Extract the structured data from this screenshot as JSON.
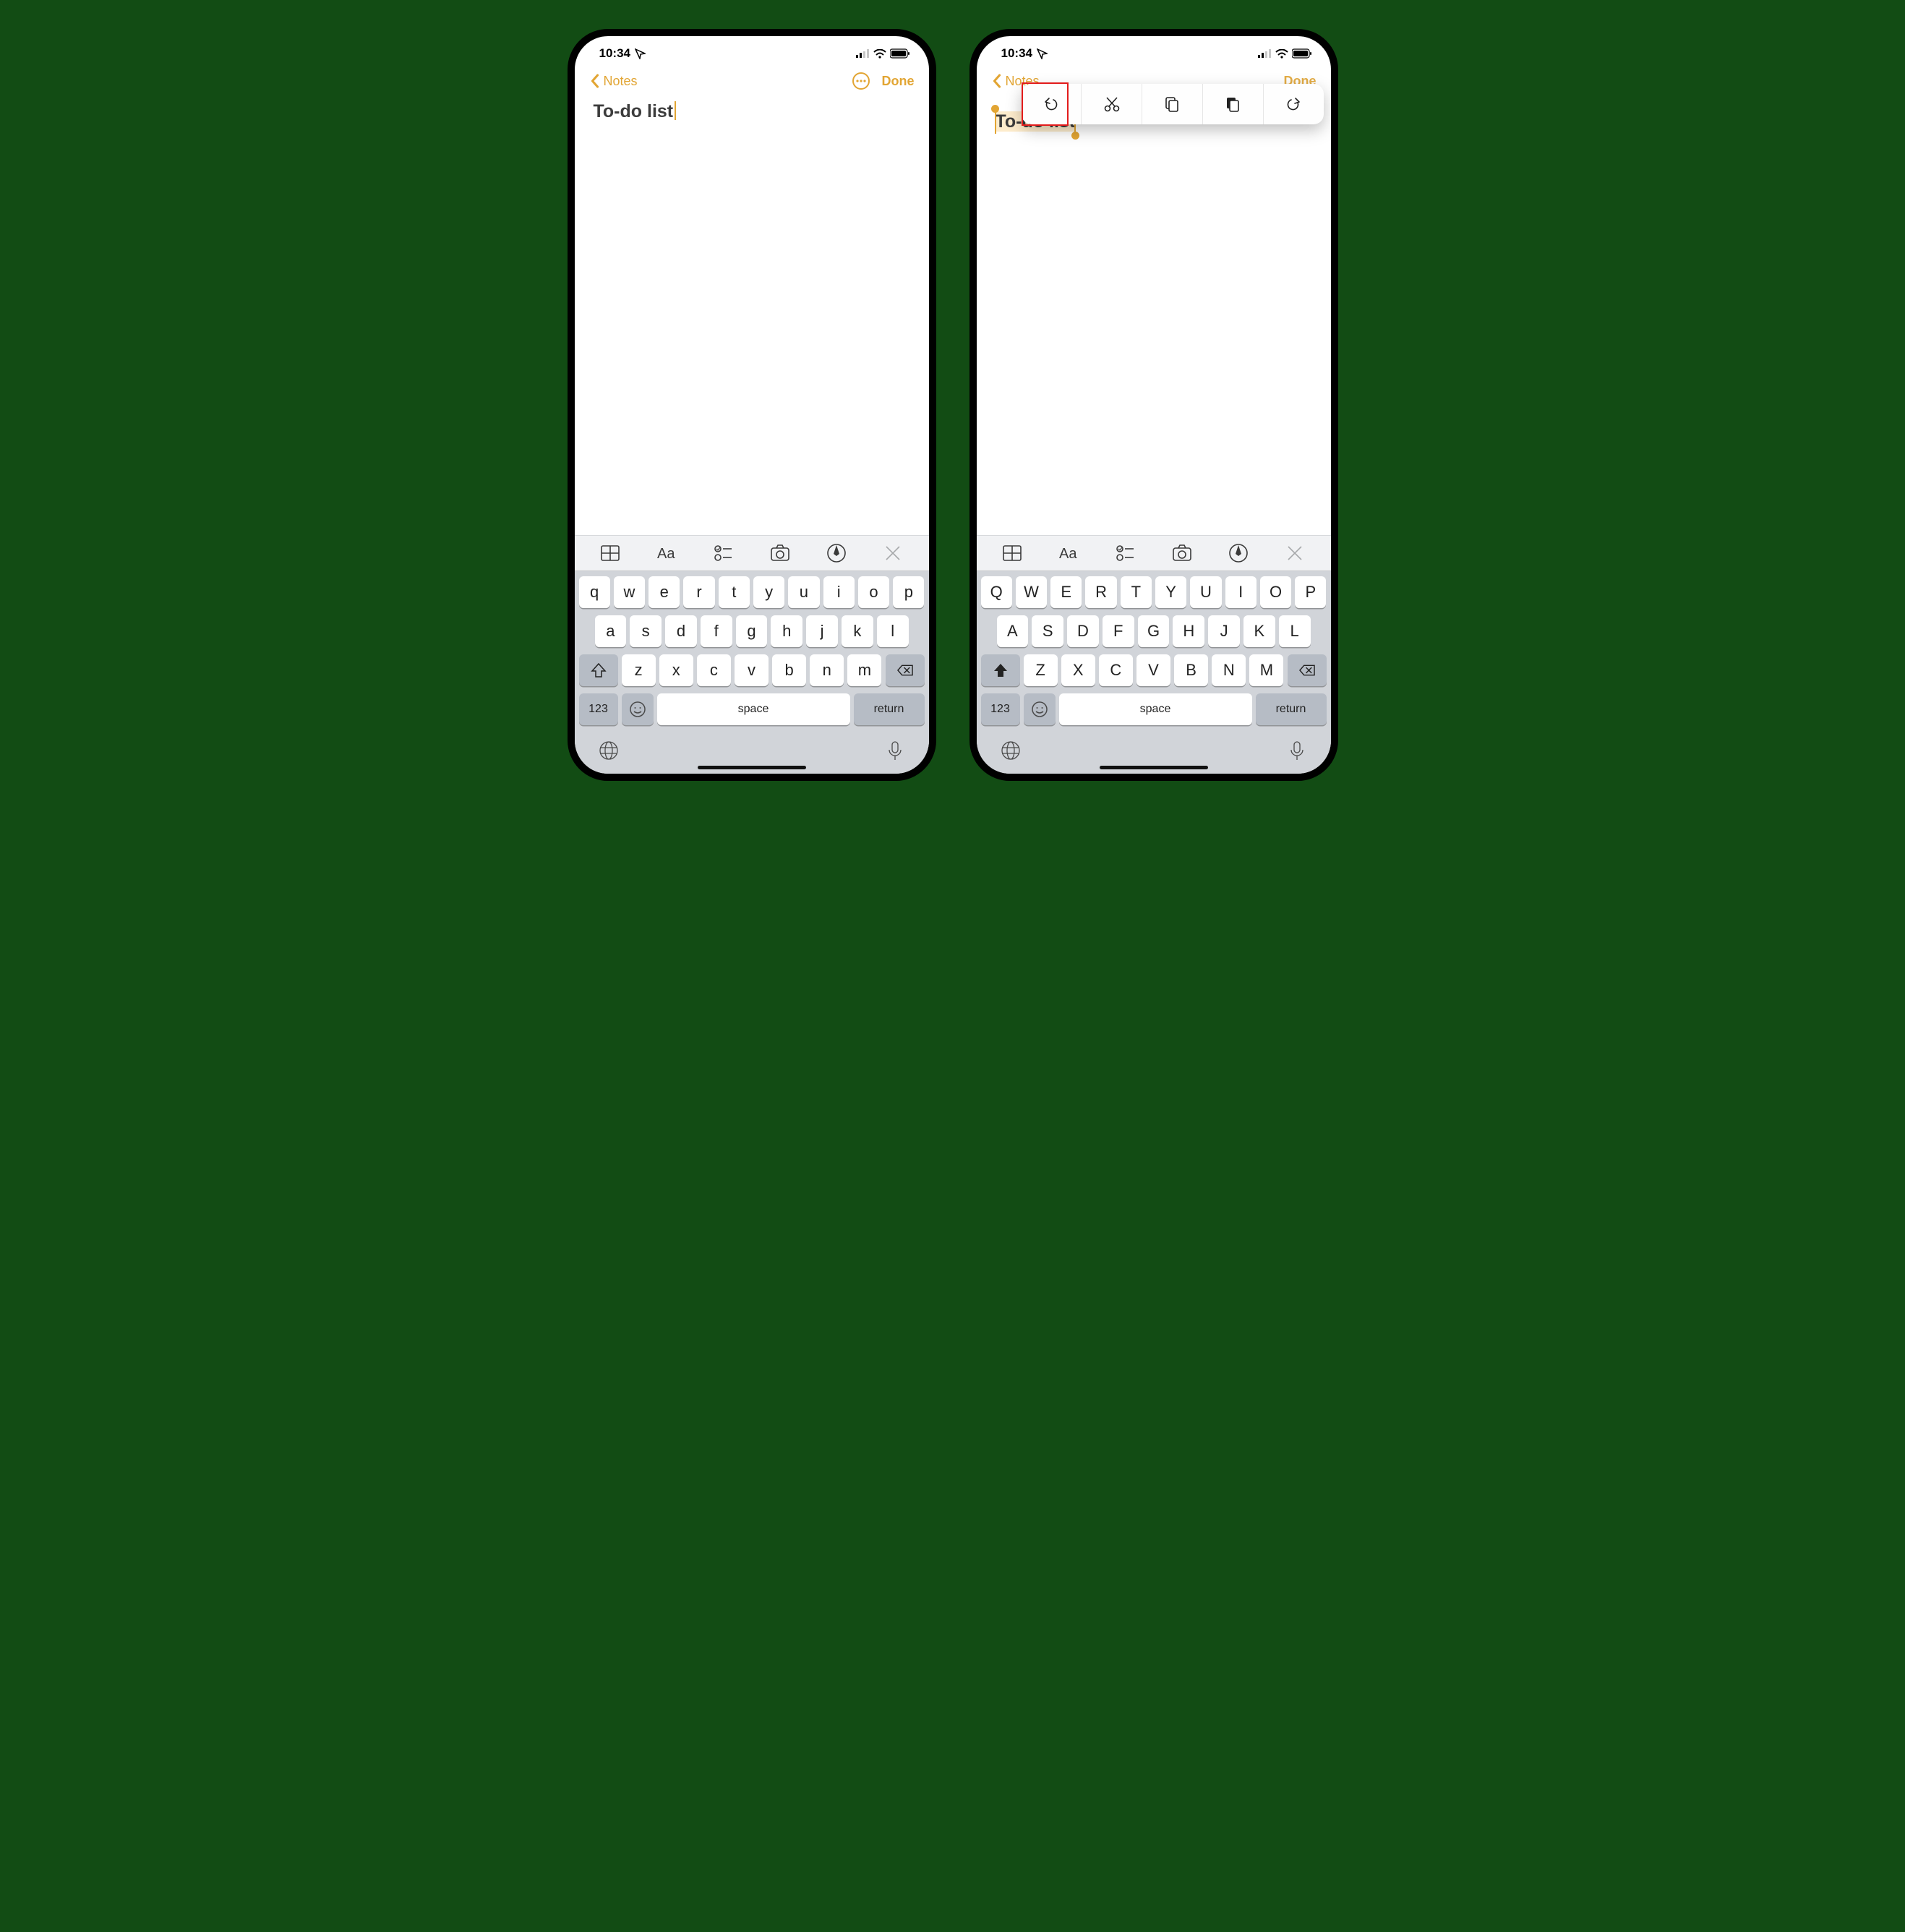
{
  "status": {
    "time": "10:34"
  },
  "nav": {
    "back_label": "Notes",
    "done_label": "Done"
  },
  "note": {
    "title": "To-do list"
  },
  "popover": {
    "items": [
      "undo",
      "cut",
      "copy",
      "paste",
      "redo"
    ]
  },
  "toolbar": {
    "items": [
      "table",
      "format-aa",
      "checklist",
      "camera",
      "markup",
      "close"
    ]
  },
  "keyboard": {
    "lower": {
      "row1": [
        "q",
        "w",
        "e",
        "r",
        "t",
        "y",
        "u",
        "i",
        "o",
        "p"
      ],
      "row2": [
        "a",
        "s",
        "d",
        "f",
        "g",
        "h",
        "j",
        "k",
        "l"
      ],
      "row3": [
        "z",
        "x",
        "c",
        "v",
        "b",
        "n",
        "m"
      ]
    },
    "upper": {
      "row1": [
        "Q",
        "W",
        "E",
        "R",
        "T",
        "Y",
        "U",
        "I",
        "O",
        "P"
      ],
      "row2": [
        "A",
        "S",
        "D",
        "F",
        "G",
        "H",
        "J",
        "K",
        "L"
      ],
      "row3": [
        "Z",
        "X",
        "C",
        "V",
        "B",
        "N",
        "M"
      ]
    },
    "num_label": "123",
    "space_label": "space",
    "return_label": "return"
  }
}
